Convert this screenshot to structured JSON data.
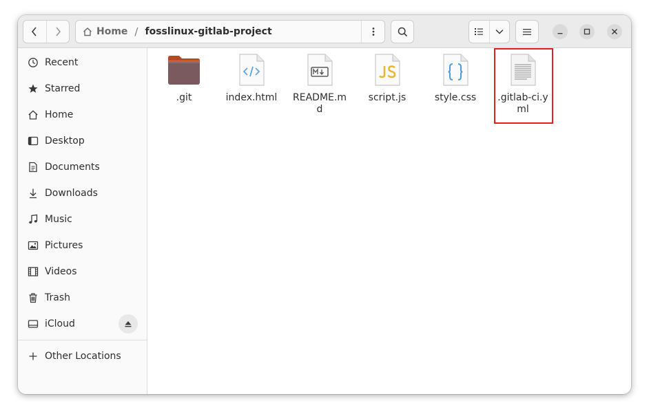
{
  "headerbar": {
    "path_home": "Home",
    "path_separator": "/",
    "path_current": "fosslinux-gitlab-project"
  },
  "sidebar": {
    "items": [
      {
        "label": "Recent",
        "icon": "clock-icon"
      },
      {
        "label": "Starred",
        "icon": "star-icon"
      },
      {
        "label": "Home",
        "icon": "home-icon"
      },
      {
        "label": "Desktop",
        "icon": "desktop-icon"
      },
      {
        "label": "Documents",
        "icon": "document-icon"
      },
      {
        "label": "Downloads",
        "icon": "download-icon"
      },
      {
        "label": "Music",
        "icon": "music-icon"
      },
      {
        "label": "Pictures",
        "icon": "picture-icon"
      },
      {
        "label": "Videos",
        "icon": "video-icon"
      },
      {
        "label": "Trash",
        "icon": "trash-icon"
      },
      {
        "label": "iCloud",
        "icon": "drive-icon"
      }
    ],
    "other_locations": "Other Locations"
  },
  "files": [
    {
      "name": ".git",
      "icon": "folder-icon"
    },
    {
      "name": "index.html",
      "icon": "html-file-icon"
    },
    {
      "name": "README.md",
      "icon": "markdown-file-icon"
    },
    {
      "name": "script.js",
      "icon": "js-file-icon"
    },
    {
      "name": "style.css",
      "icon": "css-file-icon"
    },
    {
      "name": ".gitlab-ci.yml",
      "icon": "text-file-icon"
    }
  ],
  "colors": {
    "folder": "#7a5a5e",
    "folder_tab": "#e0693a",
    "html_icon": "#5aa5e6",
    "js_icon": "#e8b832",
    "css_icon": "#4a9de0",
    "highlight": "#e0201e"
  }
}
